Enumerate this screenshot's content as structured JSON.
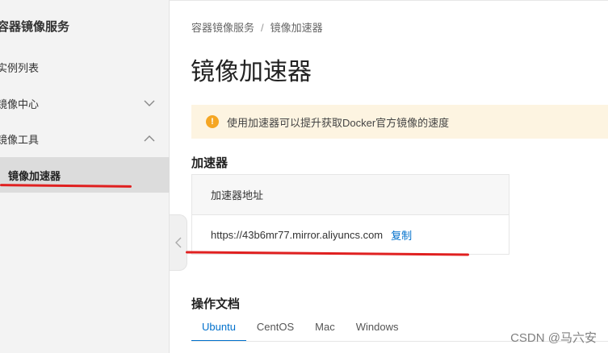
{
  "sidebar": {
    "title": "容器镜像服务",
    "items": [
      {
        "label": "实例列表"
      },
      {
        "label": "镜像中心"
      },
      {
        "label": "镜像工具"
      },
      {
        "label": "镜像加速器"
      }
    ]
  },
  "breadcrumb": {
    "root": "容器镜像服务",
    "separator": "/",
    "current": "镜像加速器"
  },
  "page": {
    "title": "镜像加速器"
  },
  "notice": {
    "icon": "info-icon",
    "icon_glyph": "!",
    "text": "使用加速器可以提升获取Docker官方镜像的速度"
  },
  "accelerator": {
    "section_title": "加速器",
    "column_header": "加速器地址",
    "url": "https://43b6mr77.mirror.aliyuncs.com",
    "copy_label": "复制"
  },
  "docs": {
    "section_title": "操作文档",
    "tabs": [
      {
        "label": "Ubuntu",
        "active": true
      },
      {
        "label": "CentOS"
      },
      {
        "label": "Mac"
      },
      {
        "label": "Windows"
      }
    ]
  },
  "watermark": "CSDN @马六安",
  "colors": {
    "accent_orange": "#ff6a00",
    "link_blue": "#0070cc",
    "notice_bg": "#fdf4e1",
    "annotation_red": "#e02020"
  }
}
